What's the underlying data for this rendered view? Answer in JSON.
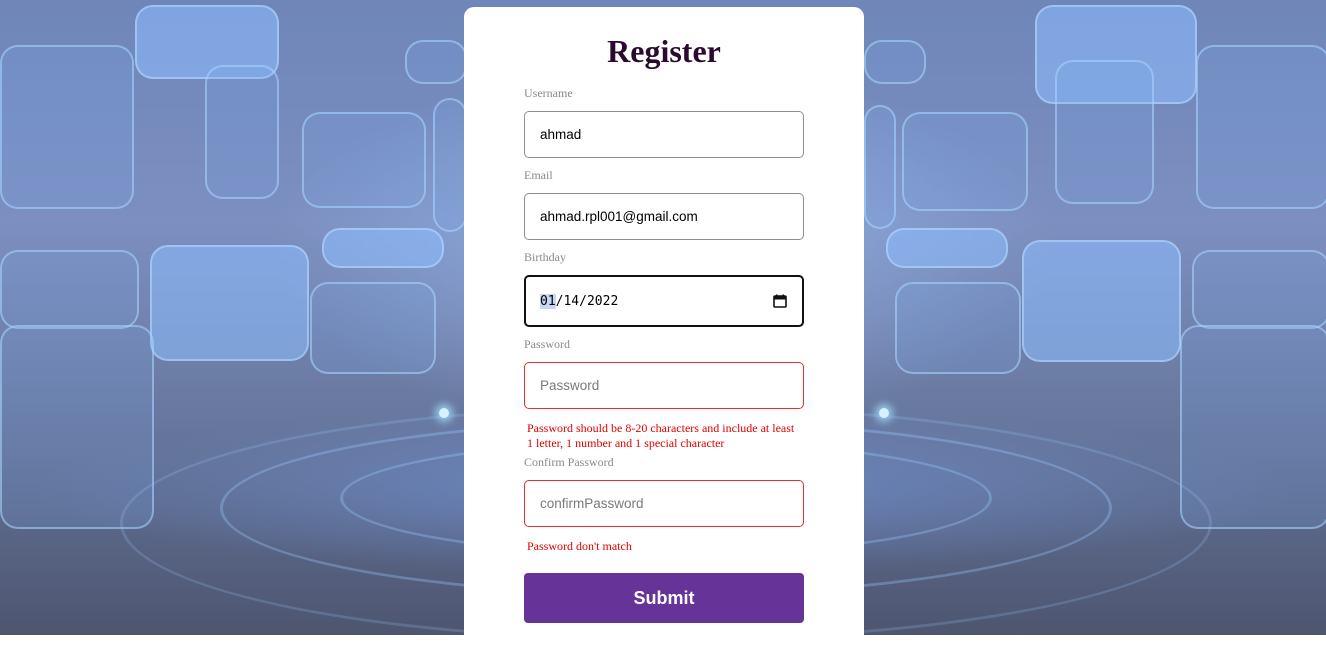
{
  "form": {
    "title": "Register",
    "username": {
      "label": "Username",
      "value": "ahmad"
    },
    "email": {
      "label": "Email",
      "value": "ahmad.rpl001@gmail.com"
    },
    "birthday": {
      "label": "Birthday",
      "month": "01",
      "day": "14",
      "year": "2022",
      "separator": "/"
    },
    "password": {
      "label": "Password",
      "placeholder": "Password",
      "error": "Password should be 8-20 characters and include at least 1 letter, 1 number and 1 special character"
    },
    "confirm_password": {
      "label": "Confirm Password",
      "placeholder": "confirmPassword",
      "error": "Password don't match"
    },
    "submit_label": "Submit"
  },
  "colors": {
    "accent": "#663399",
    "error": "#e00000",
    "title": "#2a0a2e"
  },
  "icons": {
    "calendar": "calendar-icon"
  }
}
